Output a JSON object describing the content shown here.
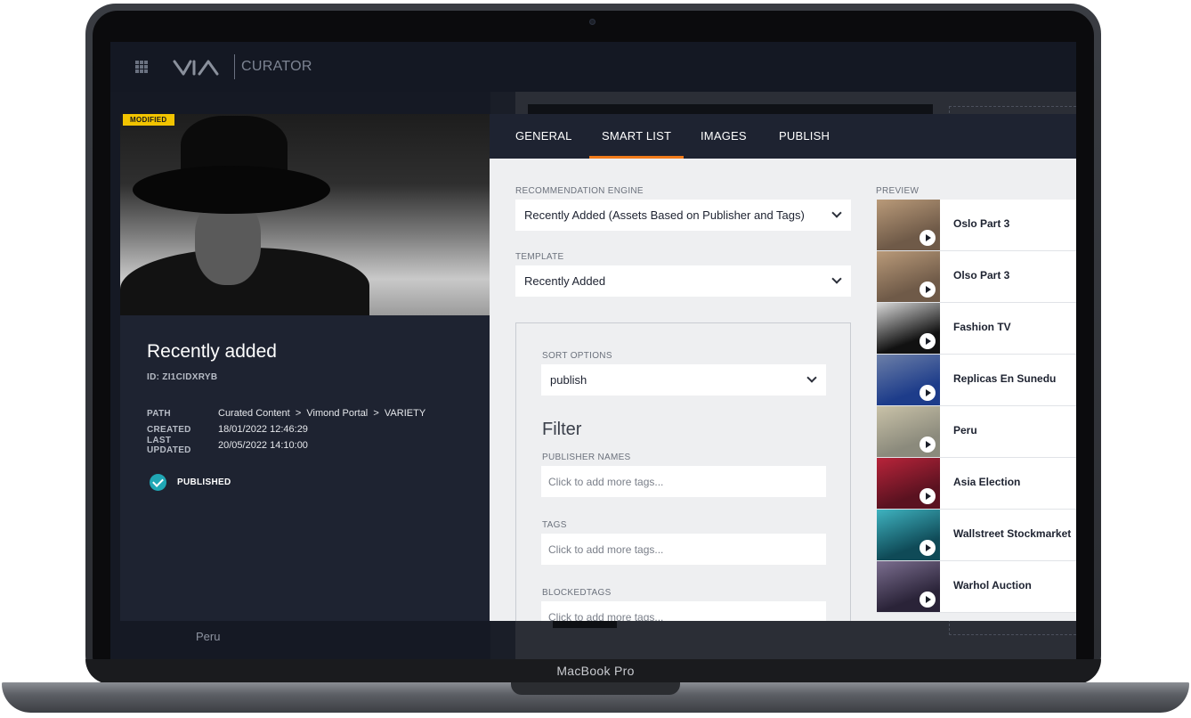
{
  "device": {
    "label": "MacBook Pro"
  },
  "app": {
    "name": "CURATOR"
  },
  "background": {
    "peru_label": "Peru"
  },
  "item": {
    "badge": "MODIFIED",
    "title": "Recently added",
    "id": "ID: ZI1CIDXRYB",
    "meta": [
      {
        "key": "PATH",
        "value": "Curated Content  >  Vimond Portal  >  VARIETY"
      },
      {
        "key": "CREATED",
        "value": "18/01/2022 12:46:29"
      },
      {
        "key": "LAST UPDATED",
        "value": "20/05/2022 14:10:00"
      }
    ],
    "status": "PUBLISHED",
    "status_color": "#20a7b5"
  },
  "tabs": [
    "GENERAL",
    "SMART LIST",
    "IMAGES",
    "PUBLISH"
  ],
  "active_tab": "SMART LIST",
  "accent_color": "#f07a1a",
  "form": {
    "engine_label": "RECOMMENDATION ENGINE",
    "engine_value": "Recently Added (Assets Based on Publisher and Tags)",
    "template_label": "TEMPLATE",
    "template_value": "Recently Added",
    "sort_label": "SORT OPTIONS",
    "sort_value": "publish",
    "filter_title": "Filter",
    "publisher_label": "PUBLISHER NAMES",
    "publisher_placeholder": "Click to add more tags...",
    "tags_label": "TAGS",
    "tags_placeholder": "Click to add more tags...",
    "blocked_label": "BLOCKEDTAGS",
    "blocked_placeholder": "Click to add more tags..."
  },
  "preview": {
    "label": "PREVIEW",
    "items": [
      {
        "title": "Oslo Part 3",
        "colors": [
          "#6f5a48",
          "#b99a79"
        ]
      },
      {
        "title": "Olso Part 3",
        "colors": [
          "#6f5a48",
          "#b99a79"
        ]
      },
      {
        "title": "Fashion TV",
        "colors": [
          "#111111",
          "#d8d8d8"
        ]
      },
      {
        "title": "Replicas En Sunedu",
        "colors": [
          "#1d3c8a",
          "#6c7fa8"
        ]
      },
      {
        "title": "Peru",
        "colors": [
          "#8b8a7c",
          "#c9c2a8"
        ]
      },
      {
        "title": "Asia Election",
        "colors": [
          "#5a1220",
          "#b8243a"
        ]
      },
      {
        "title": "Wallstreet Stockmarket",
        "colors": [
          "#0f4a57",
          "#3fb3c0"
        ]
      },
      {
        "title": "Warhol Auction",
        "colors": [
          "#2a2338",
          "#7b6e8f"
        ]
      }
    ]
  }
}
